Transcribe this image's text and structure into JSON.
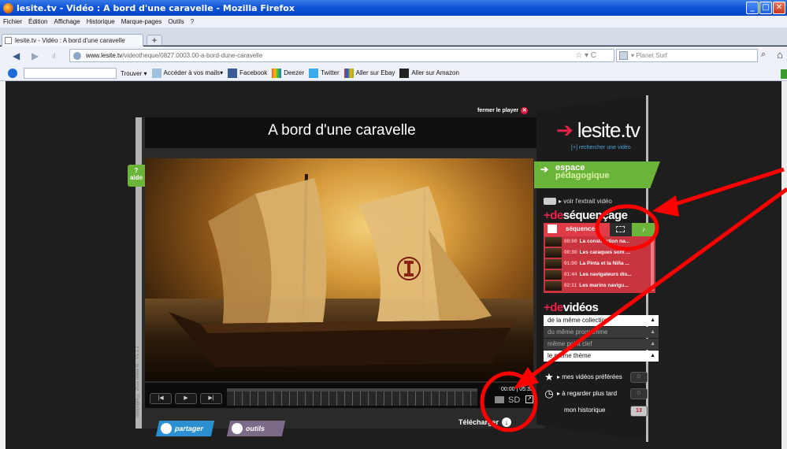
{
  "window": {
    "title": "lesite.tv - Vidéo : A bord d'une caravelle - Mozilla Firefox"
  },
  "menu": [
    "Fichier",
    "Édition",
    "Affichage",
    "Historique",
    "Marque-pages",
    "Outils",
    "?"
  ],
  "tab": {
    "label": "lesite.tv - Vidéo : A bord d'une caravelle"
  },
  "url": {
    "host": "www.lesite.tv",
    "path": "/videotheque/0827.0003.00-a-bord-dune-caravelle"
  },
  "search": {
    "placeholder": "Planet Surf"
  },
  "bookmarks": [
    "Trouver",
    "Accéder à vos mails",
    "Facebook",
    "Deezer",
    "Twitter",
    "Aller sur Ebay",
    "Aller sur Amazon"
  ],
  "player": {
    "close_label": "fermer le player",
    "title": "A bord d'une caravelle",
    "help": "?",
    "help_label": "aide",
    "copyright": "copyright © 2011 lesite.tv - V1.1.1",
    "time_current": "00:00",
    "time_total": "05:32",
    "quality": "SD",
    "share_label": "partager",
    "tools_label": "outils",
    "download_label": "Télécharger"
  },
  "side": {
    "logo": "lesite.tv",
    "search_video": "[+] rechercher une vidéo",
    "espace_1": "espace",
    "espace_2": "pédagogique",
    "extrait": "voir l'extrait vidéo",
    "sequencage_plus": "+de",
    "sequencage_title": "séquençage",
    "seq_tab": "séquences",
    "sequences": [
      {
        "time": "00:00",
        "label": "La construction na..."
      },
      {
        "time": "00:30",
        "label": "Les caraques sont ..."
      },
      {
        "time": "01:00",
        "label": "La Pinta et la Niña ..."
      },
      {
        "time": "01:44",
        "label": "Les navigateurs dis..."
      },
      {
        "time": "02:11",
        "label": "Les marins navigu..."
      }
    ],
    "videos_plus": "+de",
    "videos_title": "vidéos",
    "video_links": [
      "de la même collection",
      "du même programme",
      "même point clef",
      "le même thème"
    ],
    "favorites": "mes vidéos préférées",
    "later": "à regarder plus tard",
    "history": "mon historique",
    "favorites_count": "0",
    "later_count": "0",
    "history_count": "13"
  },
  "colors": {
    "brand_red": "#e8234a",
    "brand_green": "#6bb43a",
    "annotation": "#ff0000"
  }
}
